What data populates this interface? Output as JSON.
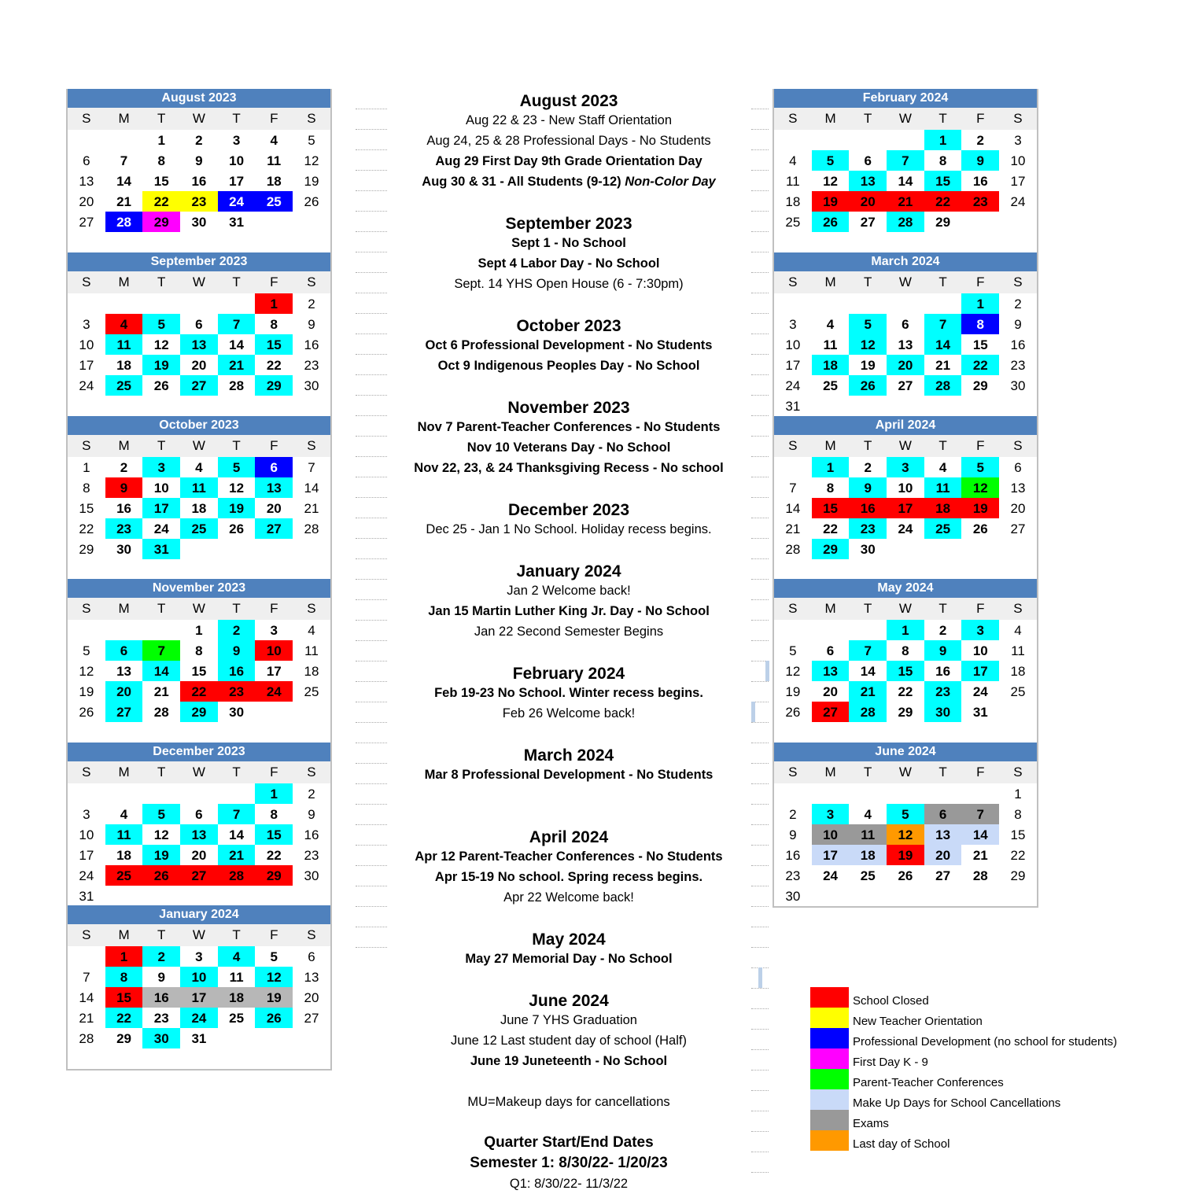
{
  "colors": {
    "header_bg": "#4f81bd",
    "school_closed": "#ff0000",
    "new_teacher_orientation": "#ffff00",
    "professional_development": "#0000ff",
    "first_day": "#ff00ff",
    "parent_teacher": "#00ff00",
    "makeup": "#c9daf8",
    "exams": "#999999",
    "last_day": "#ff9900",
    "student_day": "#00ffff"
  },
  "weekday_labels": [
    "S",
    "M",
    "T",
    "W",
    "T",
    "F",
    "S"
  ],
  "months": [
    {
      "title": "August 2023",
      "start": 2,
      "days": 31,
      "colors": {
        "22": "new_teacher_orientation",
        "23": "new_teacher_orientation",
        "24": "professional_development",
        "25": "professional_development",
        "28": "professional_development",
        "29": "first_day"
      }
    },
    {
      "title": "September 2023",
      "start": 5,
      "days": 30,
      "colors": {
        "1": "school_closed",
        "4": "school_closed",
        "5": "student_day",
        "7": "student_day",
        "11": "student_day",
        "13": "student_day",
        "15": "student_day",
        "19": "student_day",
        "21": "student_day",
        "25": "student_day",
        "27": "student_day",
        "29": "student_day"
      }
    },
    {
      "title": "October 2023",
      "start": 0,
      "days": 31,
      "colors": {
        "3": "student_day",
        "5": "student_day",
        "6": "professional_development",
        "9": "school_closed",
        "11": "student_day",
        "13": "student_day",
        "17": "student_day",
        "19": "student_day",
        "23": "student_day",
        "25": "student_day",
        "27": "student_day",
        "31": "student_day"
      }
    },
    {
      "title": "November 2023",
      "start": 3,
      "days": 30,
      "colors": {
        "2": "student_day",
        "6": "student_day",
        "7": "parent_teacher",
        "9": "student_day",
        "10": "school_closed",
        "14": "student_day",
        "16": "student_day",
        "20": "student_day",
        "22": "school_closed",
        "23": "school_closed",
        "24": "school_closed",
        "27": "student_day",
        "29": "student_day"
      }
    },
    {
      "title": "December 2023",
      "start": 5,
      "days": 31,
      "colors": {
        "1": "student_day",
        "5": "student_day",
        "7": "student_day",
        "11": "student_day",
        "13": "student_day",
        "15": "student_day",
        "19": "student_day",
        "21": "student_day",
        "25": "school_closed",
        "26": "school_closed",
        "27": "school_closed",
        "28": "school_closed",
        "29": "school_closed"
      }
    },
    {
      "title": "January 2024",
      "start": 1,
      "days": 31,
      "colors": {
        "1": "school_closed",
        "2": "student_day",
        "4": "student_day",
        "8": "student_day",
        "10": "student_day",
        "12": "student_day",
        "15": "school_closed",
        "16": "exams_light",
        "17": "exams_light",
        "18": "exams_light",
        "19": "exams_light",
        "22": "student_day",
        "24": "student_day",
        "26": "student_day",
        "30": "student_day"
      }
    },
    {
      "title": "February 2024",
      "start": 4,
      "days": 29,
      "colors": {
        "1": "student_day",
        "5": "student_day",
        "7": "student_day",
        "9": "student_day",
        "13": "student_day",
        "15": "student_day",
        "19": "school_closed",
        "20": "school_closed",
        "21": "school_closed",
        "22": "school_closed",
        "23": "school_closed",
        "26": "student_day",
        "28": "student_day"
      }
    },
    {
      "title": "March 2024",
      "start": 5,
      "days": 31,
      "colors": {
        "1": "student_day",
        "5": "student_day",
        "7": "student_day",
        "8": "professional_development",
        "12": "student_day",
        "14": "student_day",
        "18": "student_day",
        "20": "student_day",
        "22": "student_day",
        "26": "student_day",
        "28": "student_day"
      }
    },
    {
      "title": "April 2024",
      "start": 1,
      "days": 30,
      "colors": {
        "1": "student_day",
        "3": "student_day",
        "5": "student_day",
        "9": "student_day",
        "11": "student_day",
        "12": "parent_teacher",
        "15": "school_closed",
        "16": "school_closed",
        "17": "school_closed",
        "18": "school_closed",
        "19": "school_closed",
        "23": "student_day",
        "25": "student_day",
        "29": "student_day"
      }
    },
    {
      "title": "May 2024",
      "start": 3,
      "days": 31,
      "colors": {
        "1": "student_day",
        "3": "student_day",
        "7": "student_day",
        "9": "student_day",
        "13": "student_day",
        "15": "student_day",
        "17": "student_day",
        "21": "student_day",
        "23": "student_day",
        "27": "school_closed",
        "28": "student_day",
        "30": "student_day"
      }
    },
    {
      "title": "June 2024",
      "start": 6,
      "days": 30,
      "colors": {
        "3": "student_day",
        "5": "student_day",
        "6": "exams",
        "7": "exams",
        "10": "exams",
        "11": "exams",
        "12": "last_day",
        "13": "makeup",
        "14": "makeup",
        "17": "makeup",
        "18": "makeup",
        "19": "school_closed",
        "20": "makeup"
      }
    }
  ],
  "events": [
    {
      "type": "h",
      "text": "August 2023"
    },
    {
      "type": "n",
      "text": "Aug 22 & 23 - New Staff Orientation"
    },
    {
      "type": "n",
      "text": "Aug 24, 25 & 28 Professional Days - No Students"
    },
    {
      "type": "b",
      "text": "Aug 29 First Day 9th Grade Orientation Day"
    },
    {
      "type": "bi",
      "text": "Aug 30 & 31 - All Students (9-12) ",
      "italic": "Non-Color Day"
    },
    {
      "type": "gap"
    },
    {
      "type": "h",
      "text": "September 2023"
    },
    {
      "type": "b",
      "text": "Sept 1 - No School"
    },
    {
      "type": "b",
      "text": "Sept 4 Labor Day - No School"
    },
    {
      "type": "n",
      "text": "Sept. 14 YHS Open House (6 - 7:30pm)"
    },
    {
      "type": "gap"
    },
    {
      "type": "h",
      "text": "October 2023"
    },
    {
      "type": "b",
      "text": "Oct 6 Professional Development - No Students"
    },
    {
      "type": "b",
      "text": "Oct 9 Indigenous Peoples Day - No School"
    },
    {
      "type": "gap"
    },
    {
      "type": "h",
      "text": "November 2023"
    },
    {
      "type": "b",
      "text": "Nov 7 Parent-Teacher Conferences - No Students"
    },
    {
      "type": "b",
      "text": "Nov 10 Veterans Day - No School"
    },
    {
      "type": "b",
      "text": "Nov 22, 23, & 24 Thanksgiving Recess - No school"
    },
    {
      "type": "gap"
    },
    {
      "type": "h",
      "text": "December 2023"
    },
    {
      "type": "n",
      "text": "Dec 25 - Jan 1 No School. Holiday recess begins."
    },
    {
      "type": "gap"
    },
    {
      "type": "h",
      "text": "January 2024"
    },
    {
      "type": "n",
      "text": "Jan 2 Welcome back!"
    },
    {
      "type": "b",
      "text": "Jan 15 Martin Luther King Jr. Day - No School"
    },
    {
      "type": "n",
      "text": "Jan 22 Second Semester Begins"
    },
    {
      "type": "gap"
    },
    {
      "type": "h",
      "text": "February 2024"
    },
    {
      "type": "b",
      "text": "Feb 19-23 No School. Winter recess begins."
    },
    {
      "type": "n",
      "text": "Feb 26 Welcome back!"
    },
    {
      "type": "gap"
    },
    {
      "type": "h",
      "text": "March 2024"
    },
    {
      "type": "b",
      "text": "Mar 8 Professional Development - No Students"
    },
    {
      "type": "gap"
    },
    {
      "type": "gap"
    },
    {
      "type": "h",
      "text": "April 2024"
    },
    {
      "type": "b",
      "text": "Apr 12 Parent-Teacher Conferences - No Students"
    },
    {
      "type": "b",
      "text": "Apr 15-19 No school. Spring recess begins."
    },
    {
      "type": "n",
      "text": "Apr 22 Welcome back!"
    },
    {
      "type": "gap"
    },
    {
      "type": "h",
      "text": "May 2024"
    },
    {
      "type": "b",
      "text": "May 27 Memorial Day - No School"
    },
    {
      "type": "gap"
    },
    {
      "type": "h",
      "text": "June 2024"
    },
    {
      "type": "n",
      "text": "June 7 YHS Graduation"
    },
    {
      "type": "n",
      "text": "June 12 Last student day of school (Half)"
    },
    {
      "type": "b",
      "text": "June 19 Juneteenth - No School"
    },
    {
      "type": "gap"
    },
    {
      "type": "n",
      "text": "MU=Makeup days for cancellations"
    },
    {
      "type": "gap"
    },
    {
      "type": "h2",
      "text": "Quarter Start/End Dates"
    },
    {
      "type": "h2",
      "text": "Semester 1: 8/30/22- 1/20/23"
    },
    {
      "type": "n",
      "text": "Q1: 8/30/22- 11/3/22"
    }
  ],
  "legend": [
    {
      "color": "school_closed",
      "label": "School Closed"
    },
    {
      "color": "new_teacher_orientation",
      "label": "New Teacher Orientation"
    },
    {
      "color": "professional_development",
      "label": "Professional Development (no school for students)"
    },
    {
      "color": "first_day",
      "label": "First Day K - 9"
    },
    {
      "color": "parent_teacher",
      "label": "Parent-Teacher Conferences"
    },
    {
      "color": "makeup",
      "label": "Make Up Days for School Cancellations"
    },
    {
      "color": "exams",
      "label": "Exams"
    },
    {
      "color": "last_day",
      "label": "Last day of School"
    }
  ]
}
